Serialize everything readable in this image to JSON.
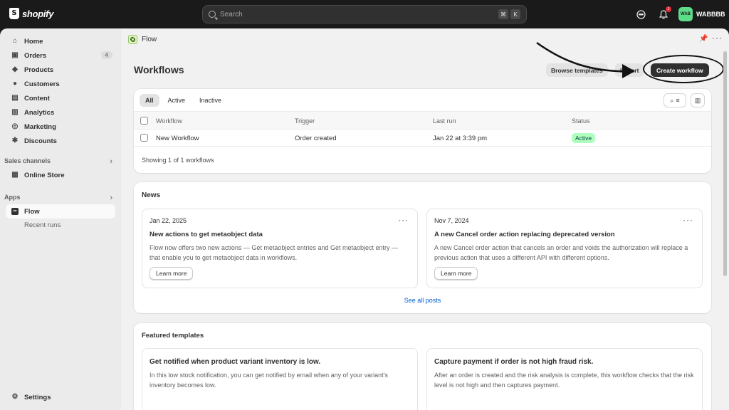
{
  "topbar": {
    "brand": "shopify",
    "search_placeholder": "Search",
    "kbd1": "⌘",
    "kbd2": "K",
    "notification_count": "1",
    "store_initials": "WAB",
    "store_name": "WABBBB"
  },
  "sidebar": {
    "items": [
      {
        "label": "Home",
        "icon": "home-icon"
      },
      {
        "label": "Orders",
        "icon": "orders-icon",
        "count": "4"
      },
      {
        "label": "Products",
        "icon": "tag-icon"
      },
      {
        "label": "Customers",
        "icon": "person-icon"
      },
      {
        "label": "Content",
        "icon": "content-icon"
      },
      {
        "label": "Analytics",
        "icon": "chart-icon"
      },
      {
        "label": "Marketing",
        "icon": "target-icon"
      },
      {
        "label": "Discounts",
        "icon": "discount-icon"
      }
    ],
    "sales_channels_label": "Sales channels",
    "online_store": "Online Store",
    "apps_label": "Apps",
    "flow": "Flow",
    "recent_runs": "Recent runs",
    "settings": "Settings"
  },
  "main": {
    "breadcrumb": "Flow",
    "title": "Workflows",
    "browse_templates": "Browse templates",
    "import": "Import",
    "create_workflow": "Create workflow",
    "tabs": [
      "All",
      "Active",
      "Inactive"
    ],
    "columns": [
      "Workflow",
      "Trigger",
      "Last run",
      "Status"
    ],
    "row": {
      "workflow": "New Workflow",
      "trigger": "Order created",
      "last_run": "Jan 22 at 3:39 pm",
      "status": "Active"
    },
    "showing": "Showing 1 of 1 workflows"
  },
  "news": {
    "title": "News",
    "posts": [
      {
        "date": "Jan 22, 2025",
        "headline": "New actions to get metaobject data",
        "body": "Flow now offers two new actions — Get metaobject entries and Get metaobject entry — that enable you to get metaobject data in workflows.",
        "cta": "Learn more"
      },
      {
        "date": "Nov 7, 2024",
        "headline": "A new Cancel order action replacing deprecated version",
        "body": "A new Cancel order action that cancels an order and voids the authorization will replace a previous action that uses a different API with different options.",
        "cta": "Learn more"
      }
    ],
    "see_all": "See all posts"
  },
  "featured": {
    "title": "Featured templates",
    "templates": [
      {
        "headline": "Get notified when product variant inventory is low.",
        "body": "In this low stock notification, you can get notified by email when any of your variant's inventory becomes low."
      },
      {
        "headline": "Capture payment if order is not high fraud risk.",
        "body": "After an order is created and the risk analysis is complete, this workflow checks that the risk level is not high and then captures payment."
      }
    ]
  },
  "colors": {
    "topbar_bg": "#1a1a1a",
    "sidebar_bg": "#ebebeb",
    "primary_button": "#303030",
    "status_active_bg": "#affebf",
    "link": "#005bd3"
  }
}
